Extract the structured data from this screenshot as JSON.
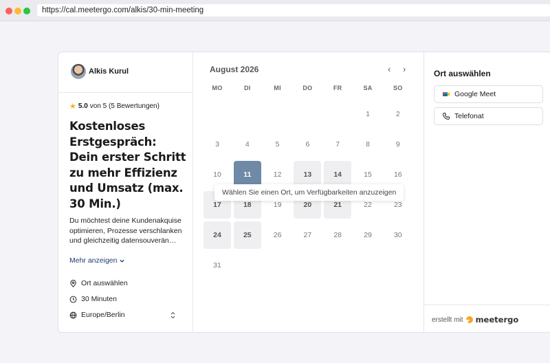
{
  "browser": {
    "url": "https://cal.meetergo.com/alkis/30-min-meeting"
  },
  "host": {
    "name": "Alkis Kurul"
  },
  "rating": {
    "score": "5.0",
    "rest": "von 5 (5 Bewertungen)"
  },
  "event": {
    "title": "Kostenloses Erstgespräch: Dein erster Schritt zu mehr Effizienz und Umsatz (max. 30 Min.)",
    "description": "Du möchtest deine Kundenakquise optimieren, Prozesse verschlanken und gleichzeitig datensouverän…",
    "more_label": "Mehr anzeigen"
  },
  "meta": {
    "location": "Ort auswählen",
    "duration": "30 Minuten",
    "timezone": "Europe/Berlin"
  },
  "calendar": {
    "month_label": "August 2026",
    "weekdays": [
      "MO",
      "DI",
      "MI",
      "DO",
      "FR",
      "SA",
      "SO"
    ],
    "weeks": [
      [
        "",
        "",
        "",
        "",
        "",
        "1",
        "2"
      ],
      [
        "3",
        "4",
        "5",
        "6",
        "7",
        "8",
        "9"
      ],
      [
        "10",
        "11",
        "12",
        "13",
        "14",
        "15",
        "16"
      ],
      [
        "17",
        "18",
        "19",
        "20",
        "21",
        "22",
        "23"
      ],
      [
        "24",
        "25",
        "26",
        "27",
        "28",
        "29",
        "30"
      ],
      [
        "31",
        "",
        "",
        "",
        "",
        "",
        ""
      ]
    ],
    "available_days": [
      "11",
      "13",
      "14",
      "17",
      "18",
      "20",
      "21",
      "24",
      "25"
    ],
    "selected_day": "11",
    "tooltip": "Wählen Sie einen Ort, um Verfügbarkeiten anzuzeigen"
  },
  "location_panel": {
    "title": "Ort auswählen",
    "options": [
      {
        "label": "Google Meet",
        "icon": "google-meet-icon"
      },
      {
        "label": "Telefonat",
        "icon": "phone-icon"
      }
    ]
  },
  "footer": {
    "made_with": "erstellt mit",
    "brand": "meetergo"
  },
  "colors": {
    "selected_day": "#6e8aa7",
    "available_day": "#efeef1",
    "link": "#1d3a6e",
    "star": "#f5b400"
  }
}
